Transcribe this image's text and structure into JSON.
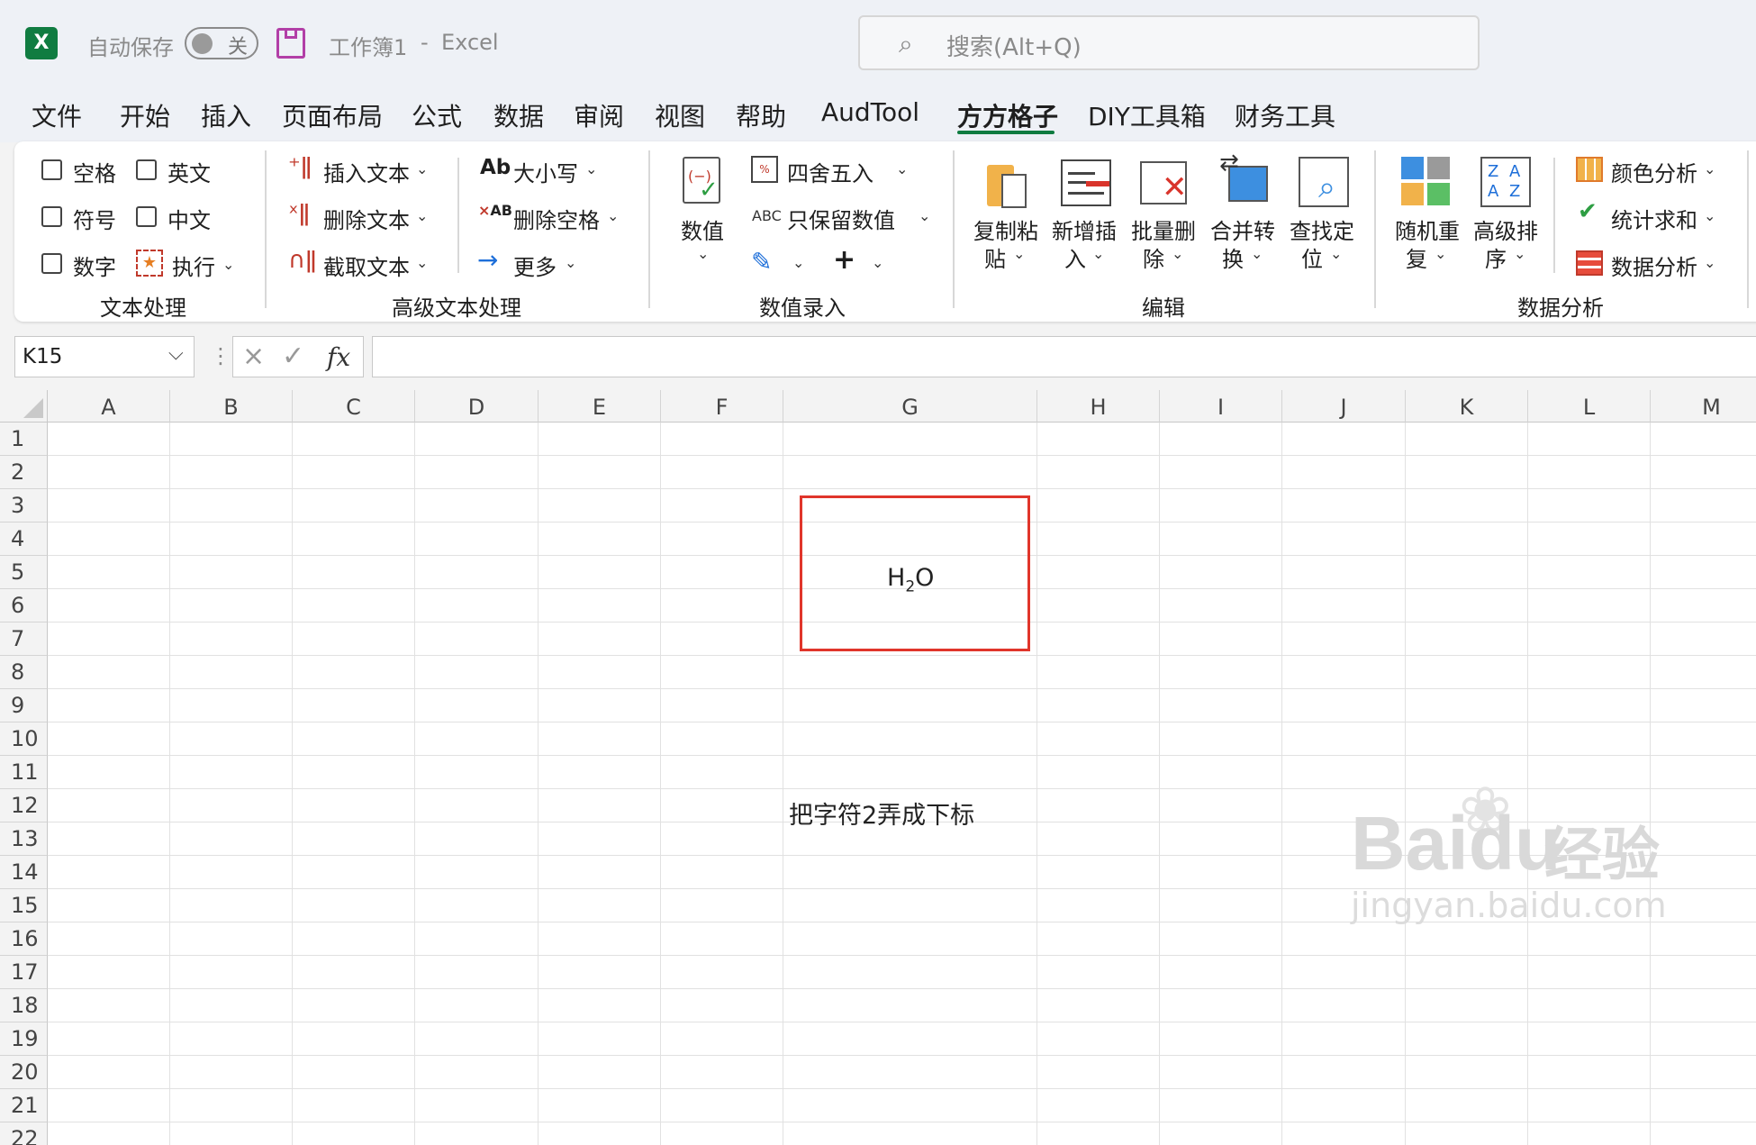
{
  "titlebar": {
    "app_icon": "X",
    "autosave_label": "自动保存",
    "toggle_state": "关",
    "workbook": "工作簿1",
    "separator": "-",
    "app_name": "Excel",
    "search_placeholder": "搜索(Alt+Q)"
  },
  "tabs": [
    "文件",
    "开始",
    "插入",
    "页面布局",
    "公式",
    "数据",
    "审阅",
    "视图",
    "帮助",
    "AudTool",
    "方方格子",
    "DIY工具箱",
    "财务工具"
  ],
  "active_tab": "方方格子",
  "ribbon": {
    "text_group": {
      "checks": [
        "空格",
        "英文",
        "符号",
        "中文",
        "数字"
      ],
      "exec": "执行",
      "label": "文本处理"
    },
    "adv_group": {
      "insert": "插入文本",
      "delete": "删除文本",
      "extract": "截取文本",
      "case": "大小写",
      "case_icon": "Ab",
      "del_space": "删除空格",
      "more": "更多",
      "label": "高级文本处理"
    },
    "num_group": {
      "value": "数值",
      "round": "四舍五入",
      "keep": "只保留数值",
      "abc": "ABC",
      "plus": "+",
      "label": "数值录入"
    },
    "edit_group": {
      "b1a": "复制粘",
      "b1b": "贴",
      "b2a": "新增插",
      "b2b": "入",
      "b3a": "批量删",
      "b3b": "除",
      "b4a": "合并转",
      "b4b": "换",
      "b5a": "查找定",
      "b5b": "位",
      "label": "编辑"
    },
    "analysis_group": {
      "r1a": "随机重",
      "r1b": "复",
      "r2a": "高级排",
      "r2b": "序",
      "color": "颜色分析",
      "sum": "统计求和",
      "data": "数据分析",
      "label": "数据分析"
    }
  },
  "formula_bar": {
    "cell_ref": "K15",
    "fx": "fx",
    "value": ""
  },
  "grid": {
    "columns": [
      "A",
      "B",
      "C",
      "D",
      "E",
      "F",
      "G",
      "H",
      "I",
      "J",
      "K",
      "L",
      "M"
    ],
    "rows": [
      "1",
      "2",
      "3",
      "4",
      "5",
      "6",
      "7",
      "8",
      "9",
      "10",
      "11",
      "12",
      "13",
      "14",
      "15",
      "16",
      "17",
      "18",
      "19",
      "20",
      "21",
      "22"
    ],
    "g5_base_h": "H",
    "g5_sub": "2",
    "g5_base_o": "O",
    "g12_note": "把字符2弄成下标"
  },
  "watermark": {
    "brand": "Bai",
    "brand2": "du",
    "cn": "经验",
    "url": "jingyan.baidu.com"
  }
}
